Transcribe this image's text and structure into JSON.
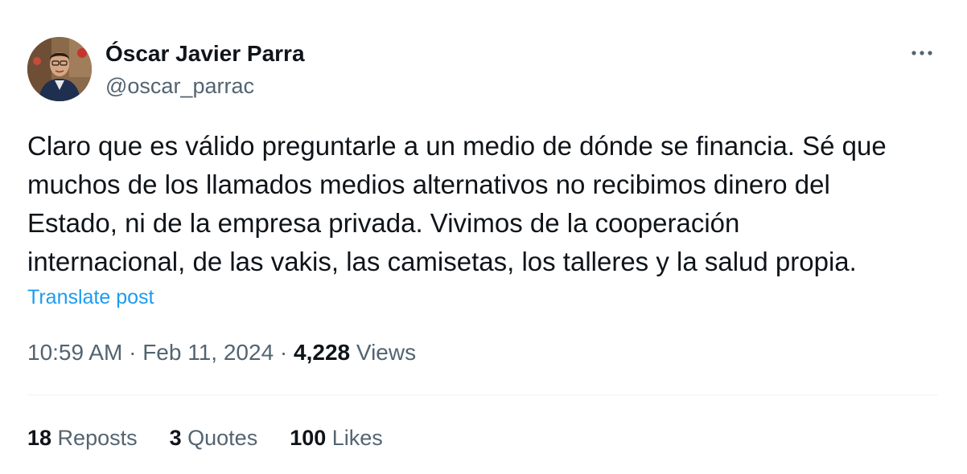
{
  "author": {
    "name": "Óscar Javier Parra",
    "handle": "@oscar_parrac"
  },
  "post": {
    "text": "Claro que es válido preguntarle a un medio de dónde se financia. Sé que\nmuchos de los llamados medios alternativos no recibimos dinero del\nEstado, ni de la empresa privada. Vivimos de la cooperación\ninternacional, de las vakis, las camisetas, los talleres y la salud propia.",
    "translate_label": "Translate post"
  },
  "meta": {
    "time": "10:59 AM",
    "sep1": " · ",
    "date": "Feb 11, 2024",
    "sep2": " · ",
    "views_count": "4,228",
    "views_label": " Views"
  },
  "stats": {
    "reposts_count": "18",
    "reposts_label": " Reposts",
    "quotes_count": "3",
    "quotes_label": " Quotes",
    "likes_count": "100",
    "likes_label": " Likes"
  },
  "icons": {
    "more": "more-options-icon",
    "avatar": "avatar"
  },
  "colors": {
    "text": "#0f1419",
    "secondary": "#536471",
    "link": "#1d9bf0",
    "divider": "#eff3f4"
  }
}
